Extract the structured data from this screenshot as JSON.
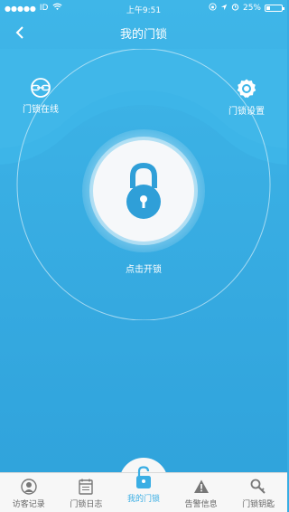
{
  "status_bar": {
    "signal": "●●●●●",
    "carrier": "ID",
    "time": "上午9:51",
    "battery_percent": "25%"
  },
  "nav": {
    "title": "我的门锁"
  },
  "top_actions": {
    "online_label": "门锁在线",
    "settings_label": "门锁设置"
  },
  "lock": {
    "label": "点击开锁"
  },
  "tabs": [
    {
      "label": "访客记录",
      "icon": "person-icon"
    },
    {
      "label": "门锁日志",
      "icon": "calendar-icon"
    },
    {
      "label": "我的门锁",
      "icon": "unlock-icon"
    },
    {
      "label": "告警信息",
      "icon": "warning-icon"
    },
    {
      "label": "门锁钥匙",
      "icon": "key-icon"
    }
  ],
  "colors": {
    "primary": "#3aaee4",
    "tab_inactive": "#666666",
    "tab_bg": "#f7f7f7"
  }
}
